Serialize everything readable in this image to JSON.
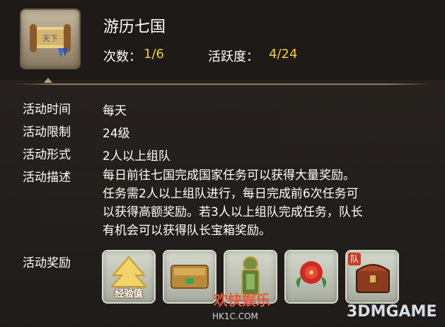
{
  "header": {
    "title": "游历七国",
    "count_label": "次数：",
    "count_value": "1/6",
    "activity_label": "活跃度：",
    "activity_value": "4/24"
  },
  "details": [
    {
      "label": "活动时间",
      "value": "每天"
    },
    {
      "label": "活动限制",
      "value": "24级"
    },
    {
      "label": "活动形式",
      "value": "2人以上组队"
    }
  ],
  "description": {
    "label": "活动描述",
    "lines": [
      "每日前往七国完成国家任务可以获得大量奖励。",
      "任务需2人以上组队进行，每日完成前6次任务可",
      "以获得高额奖励。若3人以上组队完成任务，队长",
      "有机会可以获得队长宝箱奖励。"
    ]
  },
  "rewards": {
    "label": "活动奖励",
    "items": [
      {
        "name": "经验值",
        "icon": "exp-icon"
      },
      {
        "name": "",
        "icon": "gold-bar-icon"
      },
      {
        "name": "",
        "icon": "jade-token-icon"
      },
      {
        "name": "",
        "icon": "red-flower-icon"
      },
      {
        "name": "队",
        "icon": "team-chest-icon"
      }
    ]
  },
  "watermark": {
    "site_cn": "欢快娱乐",
    "site_url": "HK1C.COM",
    "brand": "3DMGAME"
  },
  "colors": {
    "accent_yellow": "#f2d12a",
    "text": "#ffffff"
  }
}
